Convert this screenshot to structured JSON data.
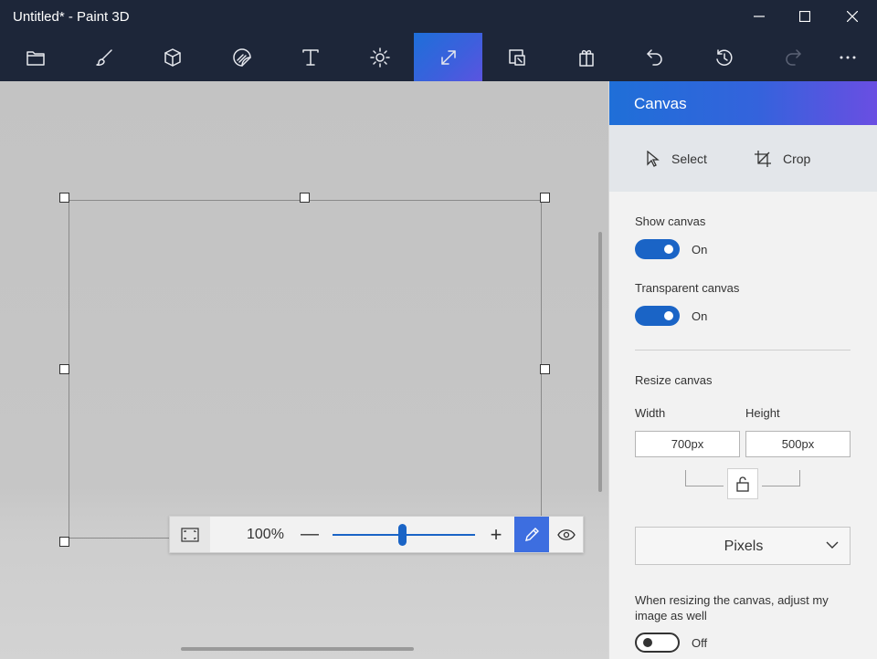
{
  "window": {
    "title": "Untitled* - Paint 3D"
  },
  "toolbar": {
    "tools": [
      {
        "name": "menu",
        "icon": "folder-icon"
      },
      {
        "name": "brushes",
        "icon": "brush-icon"
      },
      {
        "name": "3d-shapes",
        "icon": "cube-icon"
      },
      {
        "name": "stickers",
        "icon": "sticker-icon"
      },
      {
        "name": "text",
        "icon": "text-icon"
      },
      {
        "name": "effects",
        "icon": "sun-icon"
      },
      {
        "name": "canvas",
        "icon": "resize-canvas-icon",
        "active": true
      },
      {
        "name": "magic-select",
        "icon": "magic-select-icon"
      },
      {
        "name": "3d-library",
        "icon": "3d-library-icon"
      },
      {
        "name": "undo",
        "icon": "undo-icon"
      },
      {
        "name": "history",
        "icon": "history-icon"
      },
      {
        "name": "redo",
        "icon": "redo-icon",
        "disabled": true
      },
      {
        "name": "more",
        "icon": "more-icon"
      }
    ]
  },
  "zoom": {
    "value": "100%",
    "minus": "—",
    "plus": "+",
    "level": 0.5
  },
  "panel": {
    "title": "Canvas",
    "select_label": "Select",
    "crop_label": "Crop",
    "show_canvas": {
      "label": "Show canvas",
      "state": "On"
    },
    "transparent_canvas": {
      "label": "Transparent canvas",
      "state": "On"
    },
    "resize_label": "Resize canvas",
    "width_label": "Width",
    "height_label": "Height",
    "width_value": "700px",
    "height_value": "500px",
    "units": "Pixels",
    "adjust_label": "When resizing the canvas, adjust my image as well",
    "adjust_state": "Off"
  },
  "colors": {
    "titlebar": "#1d2639",
    "accent": "#1a64c6",
    "panel_gradient_start": "#1f6fd8",
    "panel_gradient_end": "#6a4ee2"
  }
}
